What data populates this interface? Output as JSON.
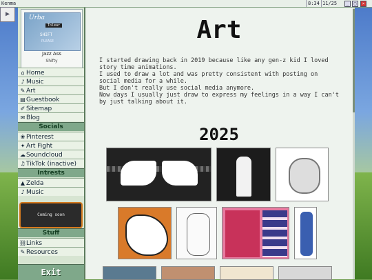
{
  "window": {
    "title": "Kenma",
    "clock": "8:34",
    "date": "11/25"
  },
  "profile": {
    "banner_name": "Urba",
    "banner_tag": "Tolear",
    "banner_sub1": "SHIFT",
    "banner_sub2": "PLEASE",
    "name": "Jazz Ass",
    "subname": "Shifty"
  },
  "sidebar": {
    "home": "Home",
    "music": "Music",
    "art": "Art",
    "guestbook": "Guestbook",
    "sitemap": "Sitemap",
    "blog": "Blog",
    "socials_header": "Socials",
    "pinterest": "Pinterest",
    "artfight": "Art Fight",
    "soundcloud": "Soundcloud",
    "tiktok": "TikTok (inactive)",
    "intrests_header": "Intrests",
    "zelda": "Zelda",
    "music2": "Music",
    "coming_soon": "Coming soon",
    "stuff_header": "Stuff",
    "links": "Links",
    "resources": "Resources",
    "exit": "Exit"
  },
  "main": {
    "title": "Art",
    "paragraph": [
      "I started drawing back in 2019 because like any gen-z kid I loved",
      "story time animations.",
      "I used to draw a lot and was pretty consistent with posting on",
      "social media for a while.",
      "But I don't really use social media anymore.",
      "Now days I usually just draw to express my feelings in a way I can't",
      "by just talking about it."
    ],
    "year": "2025"
  },
  "colors": {
    "accent": "#7fa88a",
    "sidebar_bg": "#d7e5d2",
    "content_bg": "#eef3ee",
    "coming_soon_border": "#d57a1e"
  }
}
